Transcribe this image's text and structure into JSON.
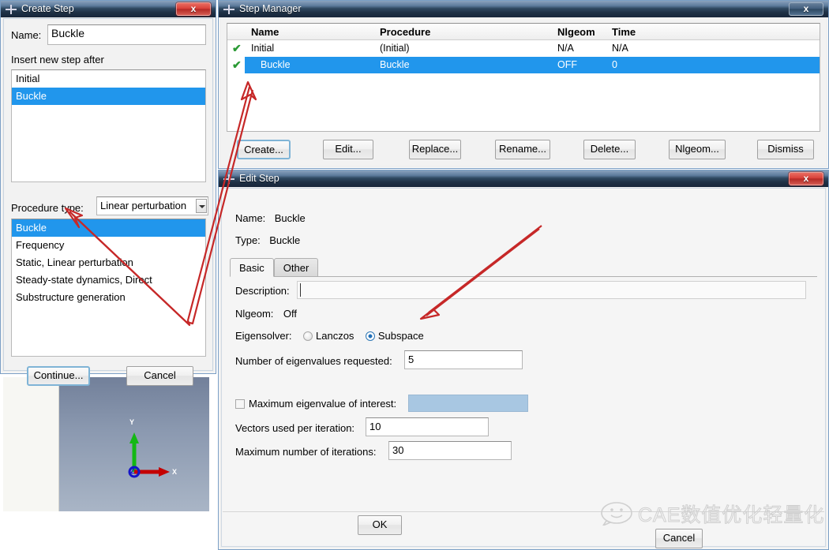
{
  "create_step": {
    "title": "Create Step",
    "icon": "crosshair-icon",
    "close_label": "x",
    "name_label": "Name:",
    "name_value": "Buckle",
    "insert_label": "Insert new step after",
    "step_list": [
      "Initial",
      "Buckle"
    ],
    "step_list_selected_index": 1,
    "procedure_type_label": "Procedure type:",
    "procedure_type_value": "Linear perturbation",
    "procedure_list": [
      "Buckle",
      "Frequency",
      "Static, Linear perturbation",
      "Steady-state dynamics, Direct",
      "Substructure generation"
    ],
    "procedure_list_selected_index": 0,
    "continue_label": "Continue...",
    "cancel_label": "Cancel"
  },
  "step_manager": {
    "title": "Step Manager",
    "icon": "crosshair-icon",
    "close_label": "x",
    "columns": [
      "Name",
      "Procedure",
      "Nlgeom",
      "Time"
    ],
    "rows": [
      {
        "check": "✔",
        "name": "Initial",
        "procedure": "(Initial)",
        "nlgeom": "N/A",
        "time": "N/A",
        "selected": false
      },
      {
        "check": "✔",
        "name": "Buckle",
        "procedure": "Buckle",
        "nlgeom": "OFF",
        "time": "0",
        "selected": true
      }
    ],
    "buttons": [
      "Create...",
      "Edit...",
      "Replace...",
      "Rename...",
      "Delete...",
      "Nlgeom...",
      "Dismiss"
    ],
    "default_button_index": 0
  },
  "edit_step": {
    "title": "Edit Step",
    "icon": "crosshair-icon",
    "close_label": "x",
    "name_label": "Name:",
    "name_value": "Buckle",
    "type_label": "Type:",
    "type_value": "Buckle",
    "tabs": [
      "Basic",
      "Other"
    ],
    "active_tab_index": 0,
    "description_label": "Description:",
    "description_value": "",
    "nlgeom_label": "Nlgeom:",
    "nlgeom_value": "Off",
    "eigensolver_label": "Eigensolver:",
    "eigensolver_options": [
      "Lanczos",
      "Subspace"
    ],
    "eigensolver_selected": "Subspace",
    "num_eigen_label": "Number of eigenvalues requested:",
    "num_eigen_value": "5",
    "max_eigen_label": "Maximum eigenvalue of interest:",
    "max_eigen_value": "",
    "max_eigen_checked": false,
    "vectors_label": "Vectors used per iteration:",
    "vectors_value": "10",
    "max_iter_label": "Maximum number of iterations:",
    "max_iter_value": "30",
    "ok_label": "OK",
    "cancel_label": "Cancel"
  },
  "viewport": {
    "axis_x": "X",
    "axis_y": "Y",
    "axis_z": "Z"
  },
  "watermark": {
    "text": "CAE数值优化轻量化",
    "icon": "wechat-smiley-icon"
  },
  "colors": {
    "selection_blue": "#2196ec",
    "annotation_red": "#c62828",
    "check_green": "#2a9a34",
    "titlebar_blue": "#24394f",
    "highlight_field": "#a8c7e2"
  }
}
